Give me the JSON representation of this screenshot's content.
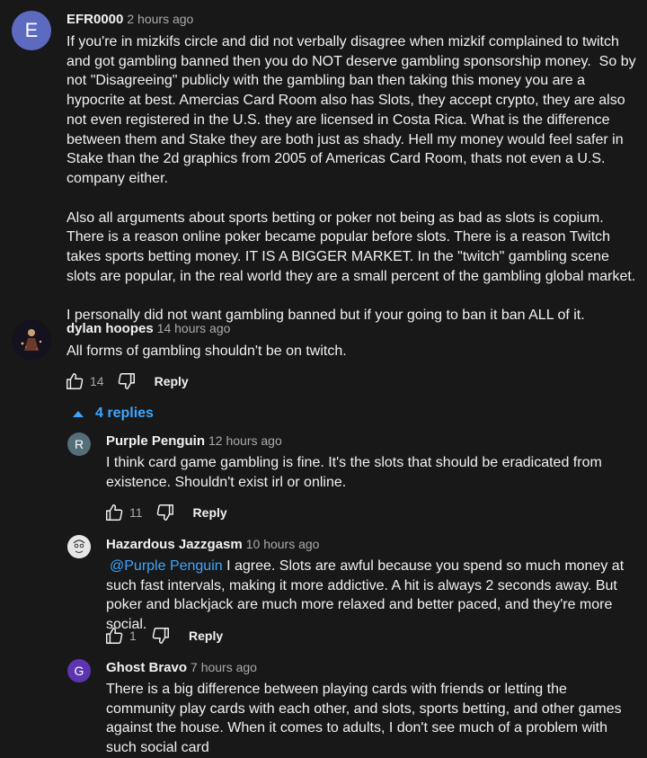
{
  "colors": {
    "background": "#181818",
    "text": "#f1f1f1",
    "muted": "#aaaaaa",
    "link": "#3ea6ff"
  },
  "comments": [
    {
      "avatar_letter": "E",
      "avatar_color": "#5c6bc0",
      "author": "EFR0000",
      "time": "2 hours ago",
      "paragraphs": [
        "If you're in mizkifs circle and did not verbally disagree when mizkif complained to twitch and got gambling banned then you do NOT deserve gambling sponsorship money.  So by not \"Disagreeing\" publicly with the gambling ban then taking this money you are a hypocrite at best. Amercias Card Room also has Slots, they accept crypto, they are also not even registered in the U.S. they are licensed in Costa Rica. What is the difference between them and Stake they are both just as shady. Hell my money would feel safer in Stake than the 2d graphics from 2005 of Americas Card Room, thats not even a U.S. company either.",
        "Also all arguments about sports betting or poker not being as bad as slots is copium. There is a reason online poker became popular before slots. There is a reason Twitch takes sports betting money. IT IS A BIGGER MARKET. In the \"twitch\" gambling scene slots are popular, in the real world they are a small percent of the gambling global market.",
        "I personally did not want gambling banned but if your going to ban it ban ALL of it."
      ]
    },
    {
      "avatar_icon": "dark-figure-avatar",
      "author": "dylan hoopes",
      "time": "14 hours ago",
      "text": "All forms of gambling shouldn't be on twitch.",
      "likes": "14",
      "reply_label": "Reply",
      "replies_toggle": "4 replies"
    }
  ],
  "replies": [
    {
      "avatar_letter": "R",
      "avatar_color": "#546e7a",
      "author": "Purple Penguin",
      "time": "12 hours ago",
      "text": "I think card game gambling is fine.  It's the slots that should be eradicated from existence. Shouldn't exist irl or online.",
      "likes": "11",
      "reply_label": "Reply"
    },
    {
      "avatar_icon": "sketch-face-avatar",
      "author": "Hazardous Jazzgasm",
      "time": "10 hours ago",
      "mention": "@Purple Penguin",
      "text": " I agree. Slots are awful because you spend so much money at such fast intervals, making it more addictive. A hit is always 2 seconds away. But poker and blackjack are much more relaxed and better paced, and they're more social.",
      "likes": "1",
      "reply_label": "Reply"
    },
    {
      "avatar_letter": "G",
      "avatar_color": "#5e35b1",
      "author": "Ghost Bravo",
      "time": "7 hours ago",
      "text": "There is a big difference between playing cards with friends or letting the community play cards with each other, and slots, sports betting, and other games against the house. When it comes to adults, I don't see much of a problem with such social card"
    }
  ]
}
